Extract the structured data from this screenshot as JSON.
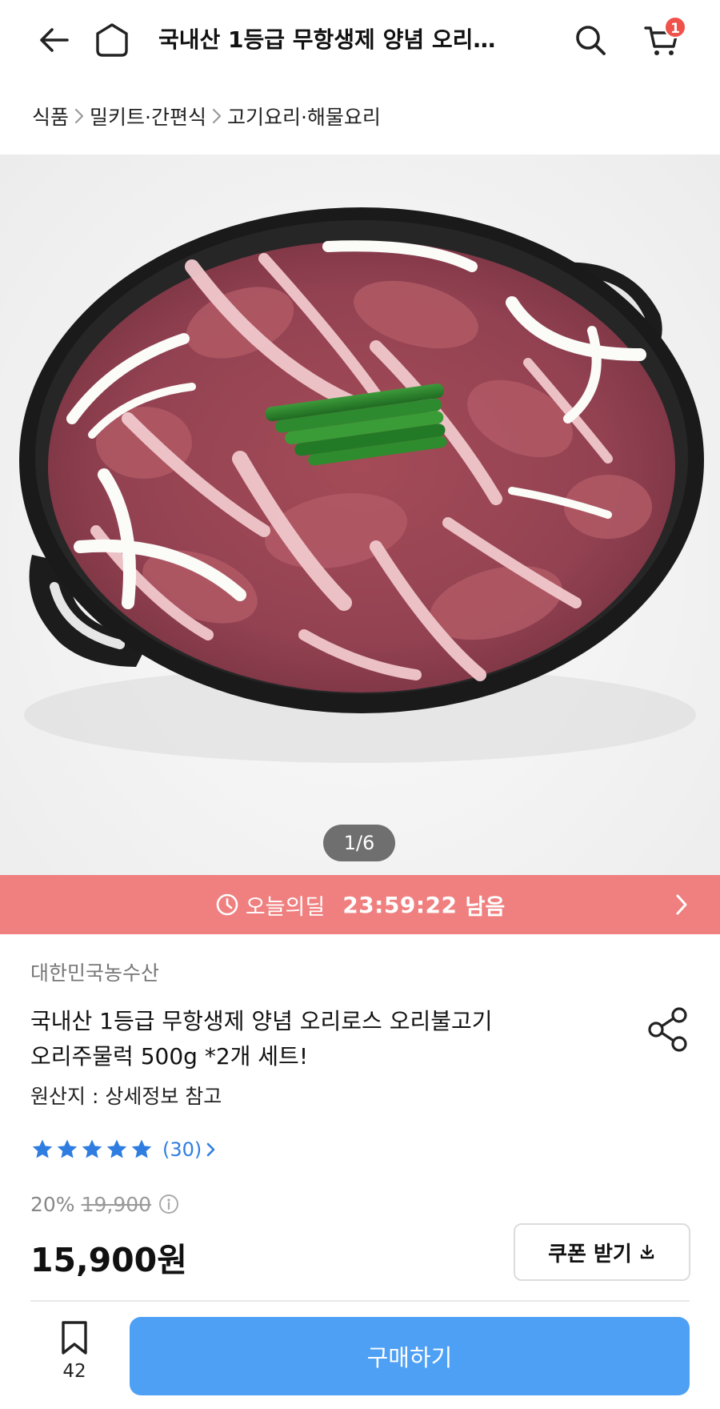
{
  "header": {
    "title": "국내산 1등급 무항생제  양념 오리…",
    "cart_count": "1",
    "icons": [
      "back-arrow-icon",
      "home-icon",
      "search-icon",
      "cart-icon"
    ]
  },
  "breadcrumb": [
    "식품",
    "밀키트·간편식",
    "고기요리·해물요리"
  ],
  "image": {
    "indicator": "1/6",
    "description_icons": [
      "cast-iron-pan",
      "sliced-duck-meat",
      "onion-slices",
      "chive-bundle"
    ]
  },
  "deal": {
    "label": "오늘의딜",
    "timer": "23:59:22",
    "remaining": "남음",
    "color": "#f08080"
  },
  "product": {
    "seller": "대한민국농수산",
    "title_line1": "국내산 1등급 무항생제  양념 오리로스 오리불고기",
    "title_line2": "오리주물럭 500g *2개 세트!",
    "origin": "원산지 : 상세정보 참고",
    "rating": 5,
    "review_count": "(30)",
    "discount_rate": "20%",
    "original_price": "19,900",
    "sale_price": "15,900원"
  },
  "actions": {
    "coupon_label": "쿠폰 받기",
    "bookmark_count": "42",
    "buy_label": "구매하기",
    "accent_color": "#4ea0f5",
    "star_color": "#2f7de1"
  }
}
